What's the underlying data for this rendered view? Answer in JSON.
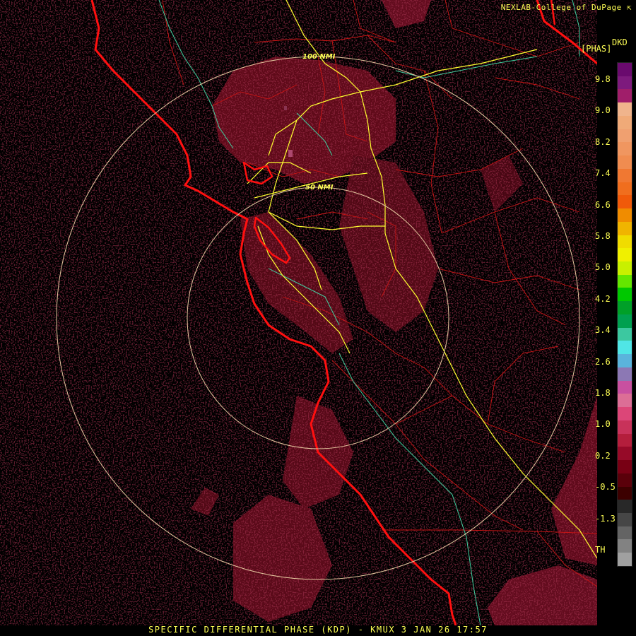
{
  "credit": "NEXLAB-College of DuPage",
  "product_code": "DKD",
  "units": "[PHAS]",
  "title": "SPECIFIC DIFFERENTIAL PHASE (KDP) - KMUX 3 JAN 26 17:57",
  "range_rings": [
    {
      "label": "100 NMI"
    },
    {
      "label": "50 NMI"
    }
  ],
  "colorbar": {
    "ticks": [
      "9.8",
      "9.0",
      "8.2",
      "7.4",
      "6.6",
      "5.8",
      "5.0",
      "4.2",
      "3.4",
      "2.6",
      "1.8",
      "1.0",
      "0.2",
      "-0.5",
      "-1.3",
      "TH"
    ],
    "colors": [
      "#6a0a6e",
      "#7d1a7d",
      "#a01e6a",
      "#f0b48c",
      "#f0aa78",
      "#f0a070",
      "#f09660",
      "#f08c50",
      "#f07832",
      "#f06e1e",
      "#f05a0a",
      "#f08c00",
      "#f0b400",
      "#f0dc00",
      "#f0f000",
      "#c8f000",
      "#64e600",
      "#00c800",
      "#00a028",
      "#00a050",
      "#3cc8a0",
      "#50e6e6",
      "#5ab4dc",
      "#8c78b4",
      "#c850a0",
      "#dc6e96",
      "#dc4678",
      "#c8325a",
      "#b41e3c",
      "#960a28",
      "#780014",
      "#5a000a",
      "#3c0000",
      "#282828",
      "#464646",
      "#646464",
      "#828282",
      "#a0a0a0"
    ]
  },
  "colors": {
    "text": "#ffff55",
    "coastline": "#ff1010",
    "boundaries": "#cc1515",
    "highways": "#ffff30",
    "rivers": "#40d0a0",
    "ring": "#e6c8a0",
    "echo": "#781020"
  }
}
